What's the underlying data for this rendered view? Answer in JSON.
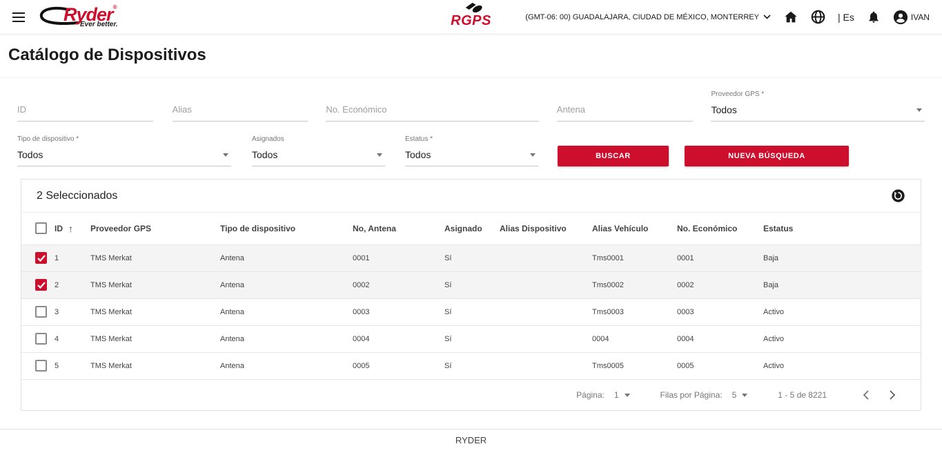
{
  "header": {
    "brand": "Ryder",
    "brand_reg": "®",
    "tagline": "Ever better.",
    "app_logo": "RGPS",
    "timezone": "(GMT-06: 00) GUADALAJARA, CIUDAD DE MÉXICO, MONTERREY",
    "language": "| Es",
    "user_name": "IVAN"
  },
  "page": {
    "title": "Catálogo de Dispositivos"
  },
  "filters": {
    "id_placeholder": "ID",
    "alias_placeholder": "Alias",
    "no_economico_placeholder": "No. Económico",
    "antena_placeholder": "Antena",
    "proveedor_gps": {
      "label": "Proveedor GPS *",
      "value": "Todos"
    },
    "tipo_dispositivo": {
      "label": "Tipo de dispositivo *",
      "value": "Todos"
    },
    "asignados": {
      "label": "Asignados",
      "value": "Todos"
    },
    "estatus": {
      "label": "Estatus *",
      "value": "Todos"
    },
    "buscar_label": "BUSCAR",
    "nueva_busqueda_label": "NUEVA BÚSQUEDA"
  },
  "table": {
    "selected_text": "2 Seleccionados",
    "columns": [
      "ID",
      "Proveedor GPS",
      "Tipo de dispositivo",
      "No, Antena",
      "Asignado",
      "Alias Dispositivo",
      "Alias Vehículo",
      "No. Económico",
      "Estatus"
    ],
    "sort_icon": "↑",
    "rows": [
      {
        "checked": true,
        "id": "1",
        "proveedor_gps": "TMS Merkat",
        "tipo": "Antena",
        "no_antena": "0001",
        "asignado": "Sí",
        "alias_dispositivo": "",
        "alias_vehiculo": "Tms0001",
        "no_economico": "0001",
        "estatus": "Baja"
      },
      {
        "checked": true,
        "id": "2",
        "proveedor_gps": "TMS Merkat",
        "tipo": "Antena",
        "no_antena": "0002",
        "asignado": "Sí",
        "alias_dispositivo": "",
        "alias_vehiculo": "Tms0002",
        "no_economico": "0002",
        "estatus": "Baja"
      },
      {
        "checked": false,
        "id": "3",
        "proveedor_gps": "TMS Merkat",
        "tipo": "Antena",
        "no_antena": "0003",
        "asignado": "Sí",
        "alias_dispositivo": "",
        "alias_vehiculo": "Tms0003",
        "no_economico": "0003",
        "estatus": "Activo"
      },
      {
        "checked": false,
        "id": "4",
        "proveedor_gps": "TMS Merkat",
        "tipo": "Antena",
        "no_antena": "0004",
        "asignado": "Sí",
        "alias_dispositivo": "",
        "alias_vehiculo": "0004",
        "no_economico": "0004",
        "estatus": "Activo"
      },
      {
        "checked": false,
        "id": "5",
        "proveedor_gps": "TMS Merkat",
        "tipo": "Antena",
        "no_antena": "0005",
        "asignado": "Sí",
        "alias_dispositivo": "",
        "alias_vehiculo": "Tms0005",
        "no_economico": "0005",
        "estatus": "Activo"
      }
    ],
    "pagination": {
      "page_label": "Página:",
      "page_value": "1",
      "rows_label": "Filas por Página:",
      "rows_value": "5",
      "range_text": "1 - 5 de 8221"
    }
  },
  "footer": {
    "text": "RYDER"
  },
  "colors": {
    "accent": "#ce0e2d",
    "selected_row_bg": "#f4f4f4"
  }
}
